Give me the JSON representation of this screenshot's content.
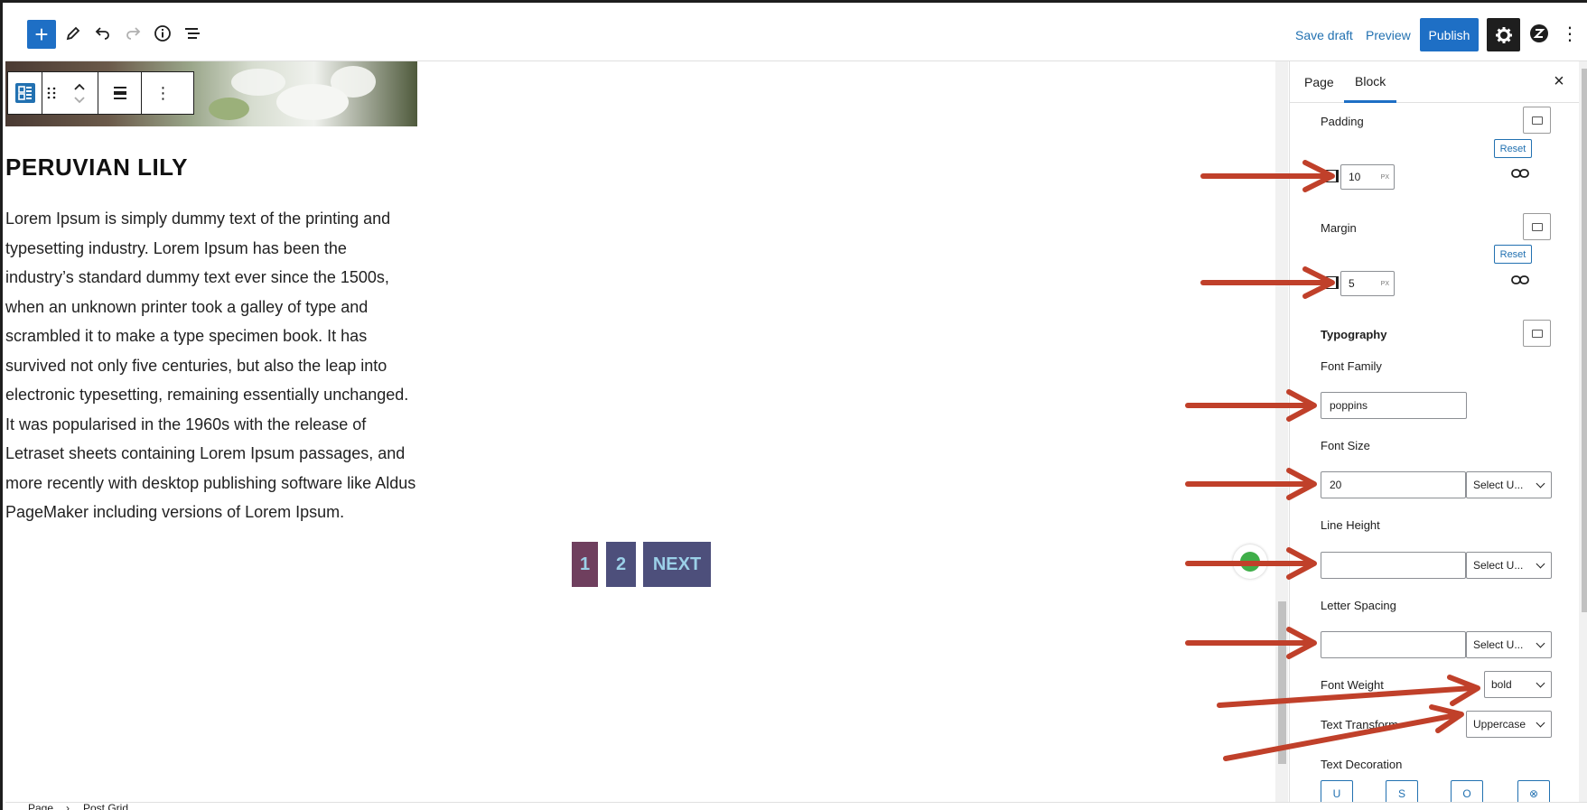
{
  "toolbar": {
    "save_draft": "Save draft",
    "preview": "Preview",
    "publish": "Publish",
    "add_icon": "+",
    "options_icon": "⋮"
  },
  "post": {
    "title": "PERUVIAN LILY",
    "body": "Lorem Ipsum is simply dummy text of the printing and typesetting industry. Lorem Ipsum has been the industry’s standard dummy text ever since the 1500s, when an unknown printer took a galley of type and scrambled it to make a type specimen book. It has survived not only five centuries, but also the leap into electronic typesetting, remaining essentially unchanged. It was popularised in the 1960s with the release of Letraset sheets containing Lorem Ipsum passages, and more recently with desktop publishing software like Aldus PageMaker including versions of Lorem Ipsum."
  },
  "pagination": {
    "page1": "1",
    "page2": "2",
    "next": "NEXT",
    "colors": {
      "current": "#6f3f5e",
      "other": "#4d4f7b",
      "text": "#9bd0e8"
    }
  },
  "sidebar": {
    "tabs": {
      "page": "Page",
      "block": "Block"
    },
    "close": "×",
    "padding": {
      "label": "Padding",
      "reset": "Reset",
      "value": "10",
      "unit": "PX"
    },
    "margin": {
      "label": "Margin",
      "reset": "Reset",
      "value": "5",
      "unit": "PX"
    },
    "typography": {
      "heading": "Typography",
      "font_family_label": "Font Family",
      "font_family_value": "poppins",
      "font_size_label": "Font Size",
      "font_size_value": "20",
      "font_size_unit": "Select U...",
      "line_height_label": "Line Height",
      "line_height_unit": "Select U...",
      "letter_spacing_label": "Letter Spacing",
      "letter_spacing_unit": "Select U...",
      "font_weight_label": "Font Weight",
      "font_weight_value": "bold",
      "text_transform_label": "Text Transform",
      "text_transform_value": "Uppercase",
      "text_decoration_label": "Text Decoration",
      "decoration_icons": [
        "U",
        "S",
        "O",
        "⊗"
      ]
    }
  },
  "breadcrumb": {
    "item1": "Page",
    "sep": "›",
    "item2": "Post Grid"
  },
  "colors": {
    "accent": "#1e6fc5",
    "annotation_arrow": "#c0402a"
  }
}
